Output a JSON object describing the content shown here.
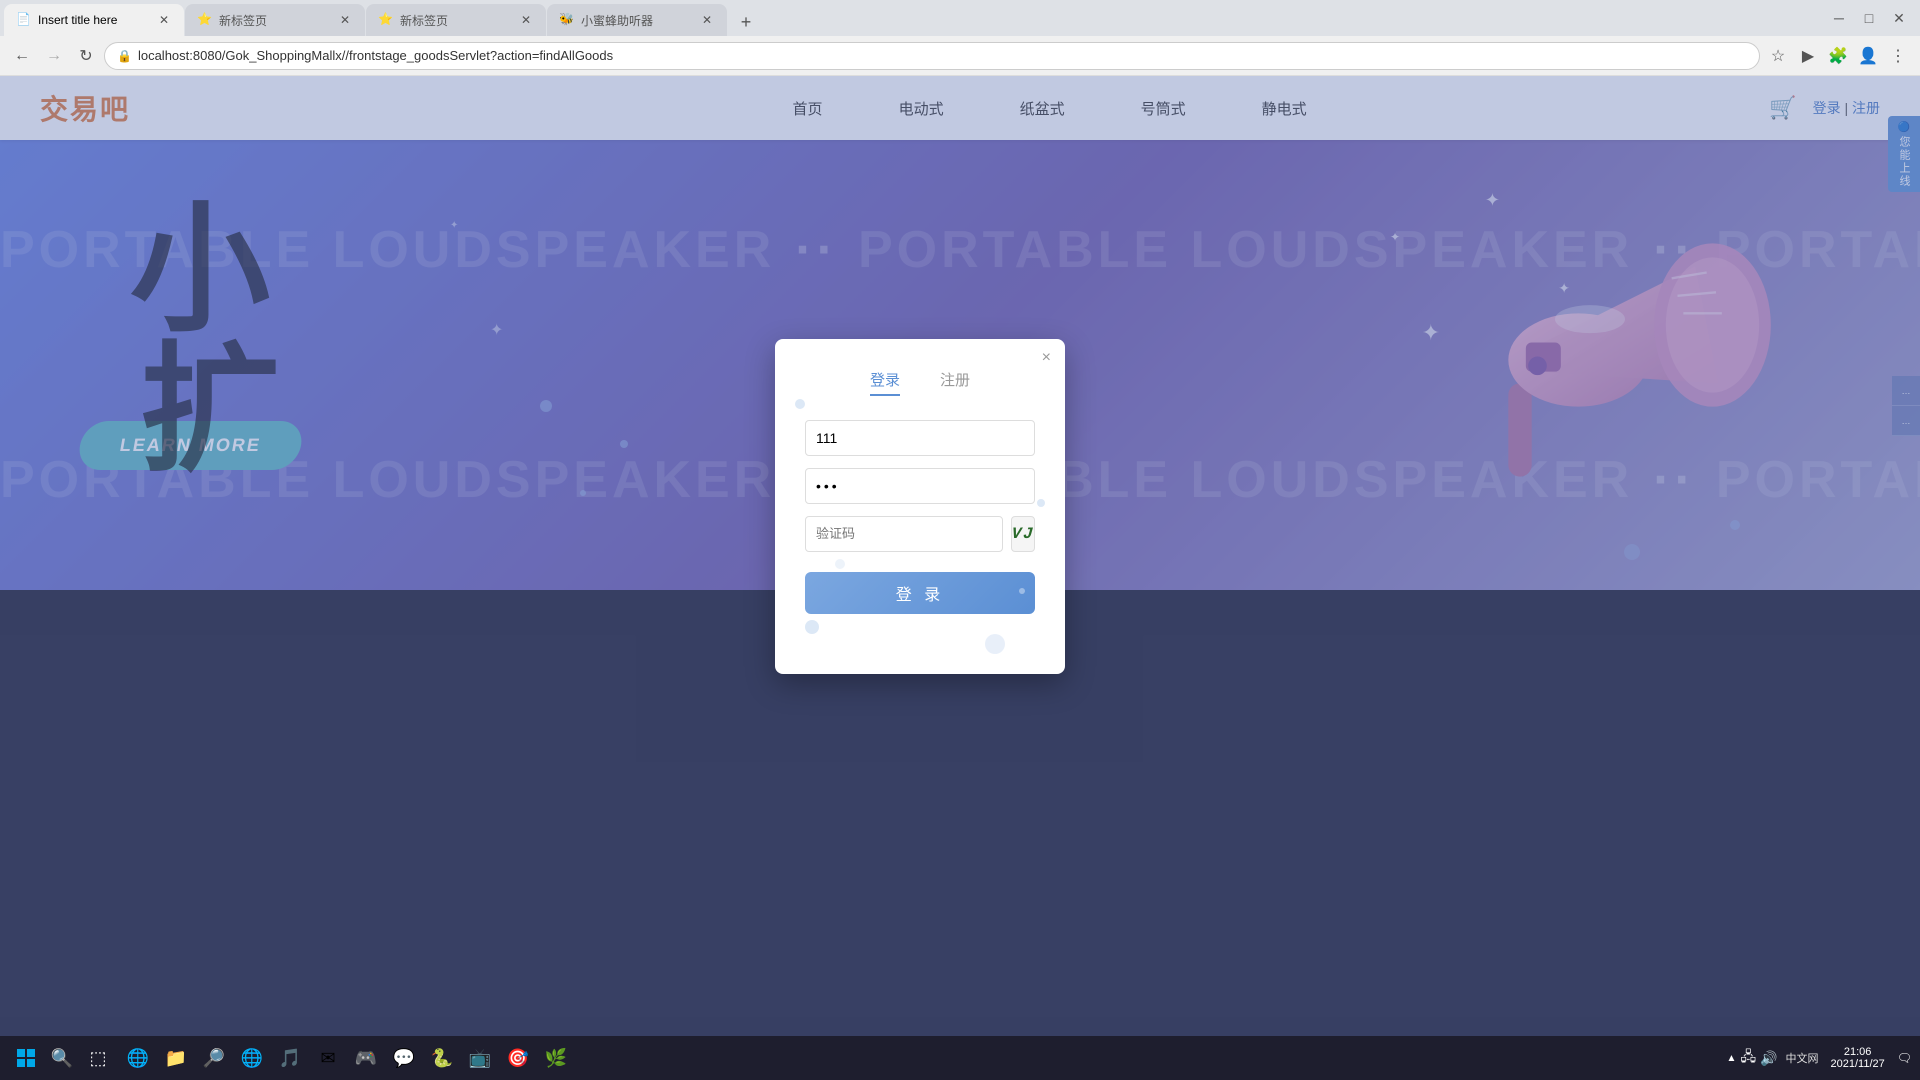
{
  "browser": {
    "tabs": [
      {
        "id": "tab1",
        "title": "Insert title here",
        "favicon": "📄",
        "active": true
      },
      {
        "id": "tab2",
        "title": "新标签页",
        "favicon": "⭐",
        "active": false
      },
      {
        "id": "tab3",
        "title": "新标签页",
        "favicon": "⭐",
        "active": false
      },
      {
        "id": "tab4",
        "title": "小蜜蜂助听器",
        "favicon": "🐝",
        "active": false
      }
    ],
    "address": "localhost:8080/Gok_ShoppingMallx//frontstage_goodsServlet?action=findAllGoods",
    "nav": {
      "back_disabled": false,
      "forward_disabled": true
    }
  },
  "site": {
    "logo": "交易吧",
    "nav_items": [
      "首页",
      "电动式",
      "纸盆式",
      "号筒式",
      "静电式"
    ],
    "login_label": "登录",
    "register_label": "注册"
  },
  "banner": {
    "text_repeat": "PORTABLE LOUDSPEAKER",
    "separator": "··",
    "chinese_chars": [
      "小",
      "扩"
    ],
    "learn_more": "LEARN MORE",
    "float_ad": "您能上线",
    "sparkle_chars": [
      "✦",
      "✦",
      "✦",
      "✦",
      "✦"
    ]
  },
  "modal": {
    "tabs": [
      {
        "label": "登录",
        "active": true
      },
      {
        "label": "注册",
        "active": false
      }
    ],
    "username_value": "111",
    "password_value": "•••",
    "captcha_placeholder": "验证码",
    "captcha_image_text": "mVJk",
    "login_button": "登 录",
    "close_button": "×"
  },
  "taskbar": {
    "time": "21:06",
    "date": "2021/11/27",
    "start_icon": "⊞",
    "search_icon": "🔍",
    "task_icon": "☰",
    "apps": [
      "🌐",
      "📁",
      "🔎",
      "🌐",
      "🎵",
      "📧",
      "🎮",
      "💬",
      "🐍"
    ],
    "right_icons": [
      "▲",
      "🔊",
      "📶"
    ]
  }
}
